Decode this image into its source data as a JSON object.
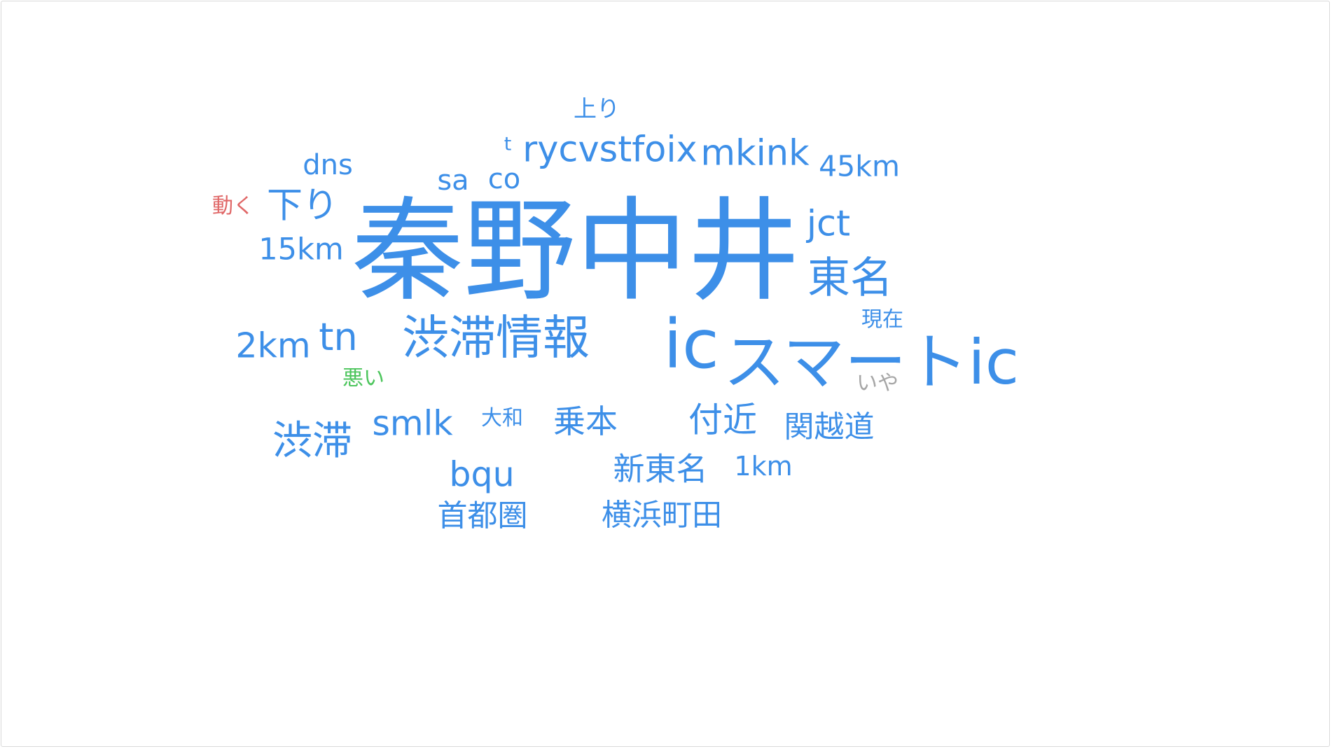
{
  "colors": {
    "default": "#3d8fe8",
    "positive": "#4cc55c",
    "negative": "#e06767",
    "neutral": "#a6a6a6"
  },
  "words": [
    {
      "id": "hadano-nakai",
      "text": "秦野中井",
      "weight": 100,
      "color": "default"
    },
    {
      "id": "ic",
      "text": "ic",
      "weight": 60,
      "color": "default"
    },
    {
      "id": "smart-ic",
      "text": "スマートic",
      "weight": 55,
      "color": "default"
    },
    {
      "id": "jutai-joho",
      "text": "渋滞情報",
      "weight": 42,
      "color": "default"
    },
    {
      "id": "tomei",
      "text": "東名",
      "weight": 38,
      "color": "default"
    },
    {
      "id": "jutai",
      "text": "渋滞",
      "weight": 36,
      "color": "default"
    },
    {
      "id": "tn",
      "text": "tn",
      "weight": 34,
      "color": "default"
    },
    {
      "id": "rycvstfoix",
      "text": "rycvstfoix",
      "weight": 32,
      "color": "default"
    },
    {
      "id": "mkink",
      "text": "mkink",
      "weight": 32,
      "color": "default"
    },
    {
      "id": "jct",
      "text": "jct",
      "weight": 32,
      "color": "default"
    },
    {
      "id": "kudari",
      "text": "下り",
      "weight": 32,
      "color": "default"
    },
    {
      "id": "2km",
      "text": "2km",
      "weight": 31,
      "color": "default"
    },
    {
      "id": "bqu",
      "text": "bqu",
      "weight": 31,
      "color": "default"
    },
    {
      "id": "smlk",
      "text": "smlk",
      "weight": 31,
      "color": "default"
    },
    {
      "id": "fukin",
      "text": "付近",
      "weight": 31,
      "color": "default"
    },
    {
      "id": "johon",
      "text": "乗本",
      "weight": 29,
      "color": "default"
    },
    {
      "id": "shin-tomei",
      "text": "新東名",
      "weight": 28,
      "color": "default"
    },
    {
      "id": "15km",
      "text": "15km",
      "weight": 27,
      "color": "default"
    },
    {
      "id": "yokohama-machida",
      "text": "横浜町田",
      "weight": 27,
      "color": "default"
    },
    {
      "id": "kanetsu-do",
      "text": "関越道",
      "weight": 27,
      "color": "default"
    },
    {
      "id": "shutoken",
      "text": "首都圏",
      "weight": 27,
      "color": "default"
    },
    {
      "id": "45km",
      "text": "45km",
      "weight": 26,
      "color": "default"
    },
    {
      "id": "dns",
      "text": "dns",
      "weight": 25,
      "color": "default"
    },
    {
      "id": "sa",
      "text": "sa",
      "weight": 25,
      "color": "default"
    },
    {
      "id": "co",
      "text": "co",
      "weight": 25,
      "color": "default"
    },
    {
      "id": "1km",
      "text": "1km",
      "weight": 24,
      "color": "default"
    },
    {
      "id": "nobori",
      "text": "上り",
      "weight": 21,
      "color": "default"
    },
    {
      "id": "genzai",
      "text": "現在",
      "weight": 19,
      "color": "default"
    },
    {
      "id": "yamato",
      "text": "大和",
      "weight": 19,
      "color": "default"
    },
    {
      "id": "t",
      "text": "t",
      "weight": 17,
      "color": "default"
    },
    {
      "id": "ugoku",
      "text": "動く",
      "weight": 19,
      "color": "negative"
    },
    {
      "id": "warui",
      "text": "悪い",
      "weight": 19,
      "color": "positive"
    },
    {
      "id": "iya",
      "text": "いや",
      "weight": 19,
      "color": "neutral"
    }
  ]
}
